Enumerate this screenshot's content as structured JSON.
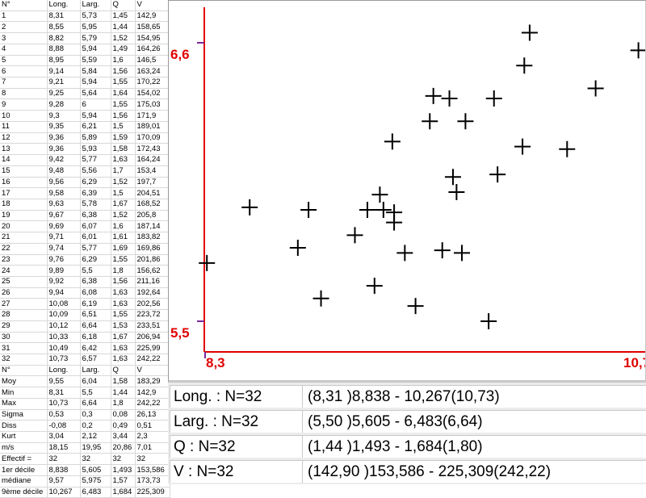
{
  "table": {
    "headers": [
      "N°",
      "Long.",
      "Larg.",
      "Q",
      "V"
    ],
    "rows": [
      [
        "1",
        "8,31",
        "5,73",
        "1,45",
        "142,9"
      ],
      [
        "2",
        "8,55",
        "5,95",
        "1,44",
        "158,65"
      ],
      [
        "3",
        "8,82",
        "5,79",
        "1,52",
        "154,95"
      ],
      [
        "4",
        "8,88",
        "5,94",
        "1,49",
        "164,26"
      ],
      [
        "5",
        "8,95",
        "5,59",
        "1,6",
        "146,5"
      ],
      [
        "6",
        "9,14",
        "5,84",
        "1,56",
        "163,24"
      ],
      [
        "7",
        "9,21",
        "5,94",
        "1,55",
        "170,22"
      ],
      [
        "8",
        "9,25",
        "5,64",
        "1,64",
        "154,02"
      ],
      [
        "9",
        "9,28",
        "6",
        "1,55",
        "175,03"
      ],
      [
        "10",
        "9,3",
        "5,94",
        "1,56",
        "171,9"
      ],
      [
        "11",
        "9,35",
        "6,21",
        "1,5",
        "189,01"
      ],
      [
        "12",
        "9,36",
        "5,89",
        "1,59",
        "170,09"
      ],
      [
        "13",
        "9,36",
        "5,93",
        "1,58",
        "172,43"
      ],
      [
        "14",
        "9,42",
        "5,77",
        "1,63",
        "164,24"
      ],
      [
        "15",
        "9,48",
        "5,56",
        "1,7",
        "153,4"
      ],
      [
        "16",
        "9,56",
        "6,29",
        "1,52",
        "197,7"
      ],
      [
        "17",
        "9,58",
        "6,39",
        "1,5",
        "204,51"
      ],
      [
        "18",
        "9,63",
        "5,78",
        "1,67",
        "168,52"
      ],
      [
        "19",
        "9,67",
        "6,38",
        "1,52",
        "205,8"
      ],
      [
        "20",
        "9,69",
        "6,07",
        "1,6",
        "187,14"
      ],
      [
        "21",
        "9,71",
        "6,01",
        "1,61",
        "183,82"
      ],
      [
        "22",
        "9,74",
        "5,77",
        "1,69",
        "169,86"
      ],
      [
        "23",
        "9,76",
        "6,29",
        "1,55",
        "201,86"
      ],
      [
        "24",
        "9,89",
        "5,5",
        "1,8",
        "156,62"
      ],
      [
        "25",
        "9,92",
        "6,38",
        "1,56",
        "211,16"
      ],
      [
        "26",
        "9,94",
        "6,08",
        "1,63",
        "192,64"
      ],
      [
        "27",
        "10,08",
        "6,19",
        "1,63",
        "202,56"
      ],
      [
        "28",
        "10,09",
        "6,51",
        "1,55",
        "223,72"
      ],
      [
        "29",
        "10,12",
        "6,64",
        "1,53",
        "233,51"
      ],
      [
        "30",
        "10,33",
        "6,18",
        "1,67",
        "206,94"
      ],
      [
        "31",
        "10,49",
        "6,42",
        "1,63",
        "225,99"
      ],
      [
        "32",
        "10,73",
        "6,57",
        "1,63",
        "242,22"
      ]
    ],
    "stats_header": [
      "N°",
      "Long.",
      "Larg.",
      "Q",
      "V"
    ],
    "stats": [
      [
        "Moy",
        "9,55",
        "6,04",
        "1,58",
        "183,29"
      ],
      [
        "Min",
        "8,31",
        "5,5",
        "1,44",
        "142,9"
      ],
      [
        "Max",
        "10,73",
        "6,64",
        "1,8",
        "242,22"
      ],
      [
        "Sigma",
        "0,53",
        "0,3",
        "0,08",
        "26,13"
      ],
      [
        "Diss",
        "-0,08",
        "0,2",
        "0,49",
        "0,51"
      ],
      [
        "Kurt",
        "3,04",
        "2,12",
        "3,44",
        "2,3"
      ],
      [
        "m/s",
        "18,15",
        "19,95",
        "20,86",
        "7,01"
      ],
      [
        "Effectif =",
        "32",
        "32",
        "32",
        "32"
      ],
      [
        "1er décile",
        "8,838",
        "5,605",
        "1,493",
        "153,586"
      ],
      [
        "médiane",
        "9,57",
        "5,975",
        "1,57",
        "173,73"
      ],
      [
        "9ème décile",
        "10,267",
        "6,483",
        "1,684",
        "225,309"
      ]
    ]
  },
  "chart_data": {
    "type": "scatter",
    "marker": "plus",
    "axis_color": "#e00000",
    "xlim": [
      8.3,
      10.7
    ],
    "ylim": [
      5.5,
      6.6
    ],
    "x_tick_labels": [
      "8,3",
      "10,7"
    ],
    "y_tick_labels": [
      "6,6",
      "5,5"
    ],
    "x": [
      8.31,
      8.55,
      8.82,
      8.88,
      8.95,
      9.14,
      9.21,
      9.25,
      9.28,
      9.3,
      9.35,
      9.36,
      9.36,
      9.42,
      9.48,
      9.56,
      9.58,
      9.63,
      9.67,
      9.69,
      9.71,
      9.74,
      9.76,
      9.89,
      9.92,
      9.94,
      10.08,
      10.09,
      10.12,
      10.33,
      10.49,
      10.73
    ],
    "y": [
      5.73,
      5.95,
      5.79,
      5.94,
      5.59,
      5.84,
      5.94,
      5.64,
      6.0,
      5.94,
      6.21,
      5.89,
      5.93,
      5.77,
      5.56,
      6.29,
      6.39,
      5.78,
      6.38,
      6.07,
      6.01,
      5.77,
      6.29,
      5.5,
      6.38,
      6.08,
      6.19,
      6.51,
      6.64,
      6.18,
      6.42,
      6.57
    ]
  },
  "summary": [
    {
      "label": "Long. : N=32",
      "range": "(8,31 )8,838 - 10,267(10,73)"
    },
    {
      "label": "Larg. : N=32",
      "range": "(5,50 )5,605 - 6,483(6,64)"
    },
    {
      "label": "Q : N=32",
      "range": "(1,44 )1,493 - 1,684(1,80)"
    },
    {
      "label": "V : N=32",
      "range": "(142,90 )153,586 - 225,309(242,22)"
    }
  ]
}
